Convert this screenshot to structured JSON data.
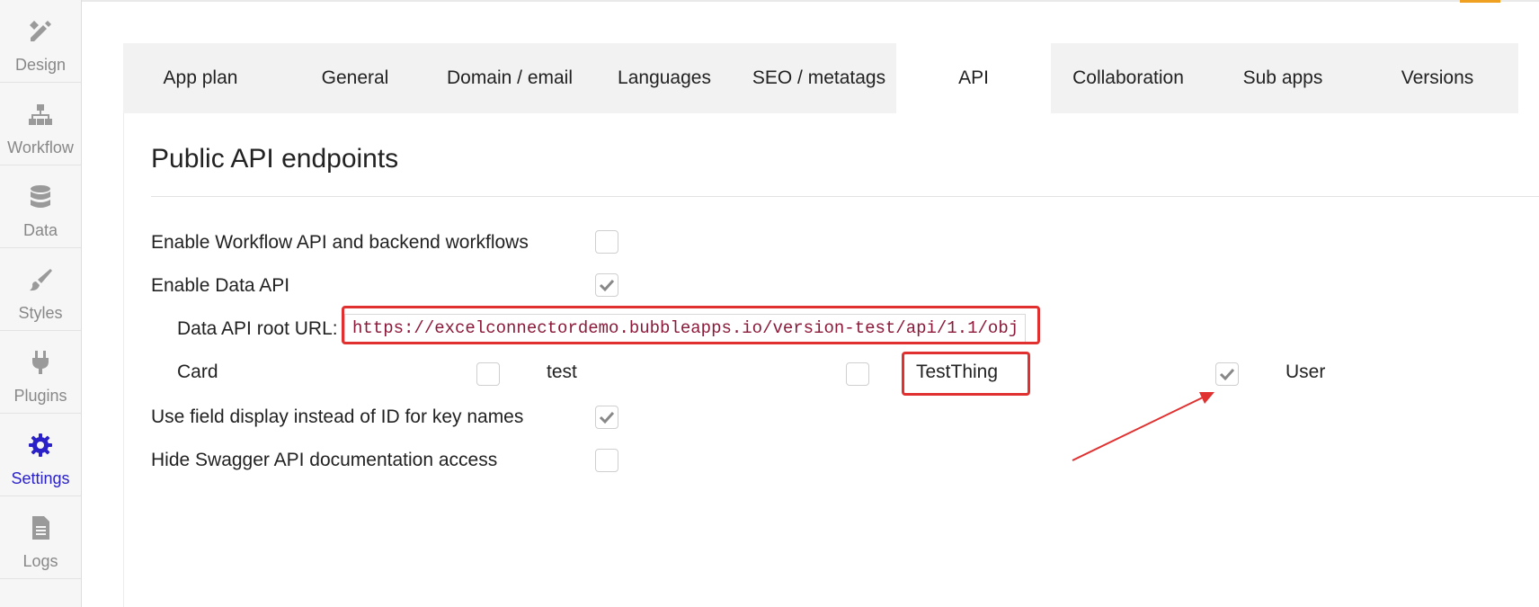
{
  "sidebar": {
    "items": [
      {
        "label": "Design",
        "icon": "pencil-ruler-icon"
      },
      {
        "label": "Workflow",
        "icon": "sitemap-icon"
      },
      {
        "label": "Data",
        "icon": "database-icon"
      },
      {
        "label": "Styles",
        "icon": "paintbrush-icon"
      },
      {
        "label": "Plugins",
        "icon": "plug-icon"
      },
      {
        "label": "Settings",
        "icon": "gear-icon",
        "active": true
      },
      {
        "label": "Logs",
        "icon": "document-icon"
      }
    ],
    "active_color": "#2a22c8"
  },
  "tabs": [
    {
      "label": "App plan"
    },
    {
      "label": "General"
    },
    {
      "label": "Domain / email"
    },
    {
      "label": "Languages"
    },
    {
      "label": "SEO / metatags"
    },
    {
      "label": "API",
      "active": true
    },
    {
      "label": "Collaboration"
    },
    {
      "label": "Sub apps"
    },
    {
      "label": "Versions"
    }
  ],
  "main": {
    "title": "Public API endpoints",
    "enable_workflow_api": {
      "label": "Enable Workflow API and backend workflows",
      "checked": false
    },
    "enable_data_api": {
      "label": "Enable Data API",
      "checked": true
    },
    "data_api_root": {
      "label": "Data API root URL:",
      "value": "https://excelconnectordemo.bubbleapps.io/version-test/api/1.1/obj"
    },
    "data_types": [
      {
        "label": "Card",
        "checked": false
      },
      {
        "label": "test",
        "checked": false
      },
      {
        "label": "TestThing",
        "checked": true
      },
      {
        "label": "User",
        "checked": false
      }
    ],
    "use_field_display": {
      "label": "Use field display instead of ID for key names",
      "checked": true
    },
    "hide_swagger": {
      "label": "Hide Swagger API documentation access",
      "checked": false
    }
  },
  "annotation_color": "#e03030"
}
